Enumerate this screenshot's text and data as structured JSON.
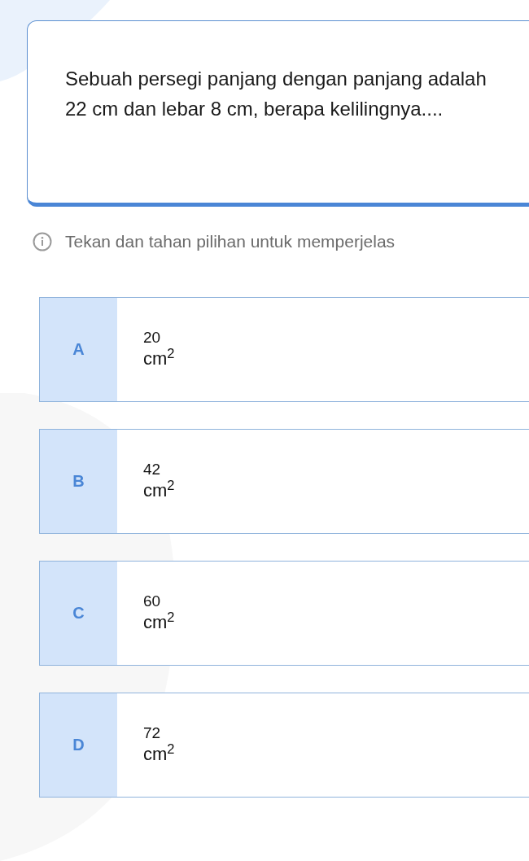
{
  "question": {
    "text": "Sebuah persegi panjang dengan panjang adalah 22 cm dan lebar 8 cm, berapa kelilingnya...."
  },
  "hint": {
    "text": "Tekan dan tahan pilihan untuk memperjelas"
  },
  "options": [
    {
      "letter": "A",
      "value": "20",
      "unit": "cm$^{2}$"
    },
    {
      "letter": "B",
      "value": "42",
      "unit": "cm$^{2}$"
    },
    {
      "letter": "C",
      "value": "60",
      "unit": "cm$^{2}$"
    },
    {
      "letter": "D",
      "value": "72",
      "unit": "cm$^{2}$"
    }
  ]
}
